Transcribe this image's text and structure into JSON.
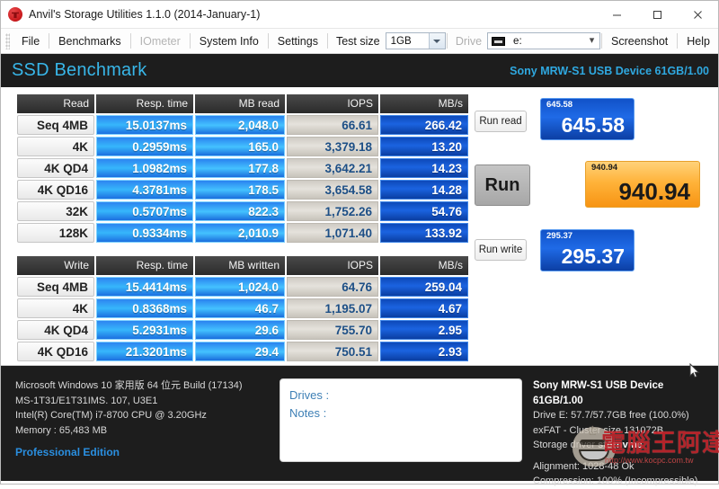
{
  "window": {
    "title": "Anvil's Storage Utilities 1.1.0 (2014-January-1)",
    "icon": "anvil-icon",
    "minimize_label": "–",
    "maximize_label": "□",
    "close_label": "✕"
  },
  "menu": {
    "items": [
      {
        "label": "File",
        "disabled": false
      },
      {
        "label": "Benchmarks",
        "disabled": false
      },
      {
        "label": "IOmeter",
        "disabled": true
      },
      {
        "label": "System Info",
        "disabled": false
      },
      {
        "label": "Settings",
        "disabled": false
      }
    ],
    "test_size_label": "Test size",
    "test_size_value": "1GB",
    "drive_label": "Drive",
    "drive_value": "e:",
    "screenshot_label": "Screenshot",
    "help_label": "Help"
  },
  "header": {
    "title": "SSD Benchmark",
    "device": "Sony MRW-S1 USB Device 61GB/1.00",
    "accent_color": "#2fa8e0",
    "background_color": "#1d1d1d"
  },
  "read_table": {
    "columns": [
      "Read",
      "Resp. time",
      "MB read",
      "IOPS",
      "MB/s"
    ],
    "rows": [
      {
        "label": "Seq 4MB",
        "resp": "15.0137ms",
        "mb": "2,048.0",
        "iops": "66.61",
        "mbs": "266.42"
      },
      {
        "label": "4K",
        "resp": "0.2959ms",
        "mb": "165.0",
        "iops": "3,379.18",
        "mbs": "13.20"
      },
      {
        "label": "4K QD4",
        "resp": "1.0982ms",
        "mb": "177.8",
        "iops": "3,642.21",
        "mbs": "14.23"
      },
      {
        "label": "4K QD16",
        "resp": "4.3781ms",
        "mb": "178.5",
        "iops": "3,654.58",
        "mbs": "14.28"
      },
      {
        "label": "32K",
        "resp": "0.5707ms",
        "mb": "822.3",
        "iops": "1,752.26",
        "mbs": "54.76"
      },
      {
        "label": "128K",
        "resp": "0.9334ms",
        "mb": "2,010.9",
        "iops": "1,071.40",
        "mbs": "133.92"
      }
    ]
  },
  "write_table": {
    "columns": [
      "Write",
      "Resp. time",
      "MB written",
      "IOPS",
      "MB/s"
    ],
    "rows": [
      {
        "label": "Seq 4MB",
        "resp": "15.4414ms",
        "mb": "1,024.0",
        "iops": "64.76",
        "mbs": "259.04"
      },
      {
        "label": "4K",
        "resp": "0.8368ms",
        "mb": "46.7",
        "iops": "1,195.07",
        "mbs": "4.67"
      },
      {
        "label": "4K QD4",
        "resp": "5.2931ms",
        "mb": "29.6",
        "iops": "755.70",
        "mbs": "2.95"
      },
      {
        "label": "4K QD16",
        "resp": "21.3201ms",
        "mb": "29.4",
        "iops": "750.51",
        "mbs": "2.93"
      }
    ]
  },
  "scores": {
    "run_read_label": "Run read",
    "run_label": "Run",
    "run_write_label": "Run write",
    "read_score": "645.58",
    "read_score_mini": "645.58",
    "total_score": "940.94",
    "total_score_mini": "940.94",
    "write_score": "295.37",
    "write_score_mini": "295.37",
    "read_color": "#1f6ae6",
    "total_color": "#ffb33a",
    "write_color": "#1f6ae6"
  },
  "footer": {
    "system": [
      "Microsoft Windows 10 家用版 64 位元 Build (17134)",
      "MS-1T31/E1T31IMS. 107, U3E1",
      "Intel(R) Core(TM) i7-8700 CPU @ 3.20GHz",
      "Memory : 65,483 MB"
    ],
    "edition": "Professional Edition",
    "notes": {
      "drives_label": "Drives :",
      "notes_label": "Notes :"
    },
    "drive": {
      "title": "Sony MRW-S1 USB Device 61GB/1.00",
      "capacity": "Drive E: 57.7/57.7GB free (100.0%)",
      "filesystem": "exFAT - Cluster size 131072B",
      "driver_label": "Storage driver",
      "driver_value": "stornvme",
      "alignment": "Alignment: 1028-48 Ok",
      "compression": "Compression: 100% (Incompressible)"
    }
  },
  "watermark": {
    "text": "電腦王阿達",
    "url": "http://www.kocpc.com.tw"
  }
}
